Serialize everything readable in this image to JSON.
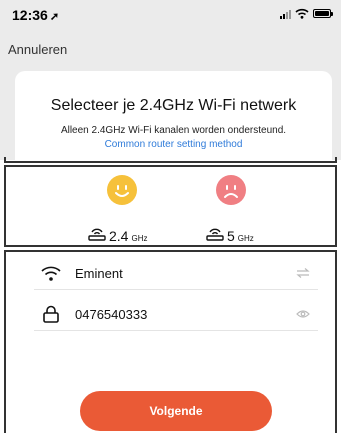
{
  "status_bar": {
    "time": "12:36",
    "location_icon": "location-arrow-icon",
    "signal_icon": "signal-icon",
    "wifi_icon": "wifi-icon",
    "battery_icon": "battery-icon"
  },
  "header": {
    "cancel_label": "Annuleren"
  },
  "card": {
    "title": "Selecteer je 2.4GHz Wi-Fi netwerk",
    "subtitle": "Alleen 2.4GHz Wi-Fi kanalen worden ondersteund.",
    "link_text": "Common router setting method"
  },
  "bands": [
    {
      "freq": "2.4",
      "unit": "GHz",
      "status": "supported",
      "face_icon": "happy-face-icon",
      "color": "#f6c13b"
    },
    {
      "freq": "5",
      "unit": "GHz",
      "status": "not-supported",
      "face_icon": "sad-face-icon",
      "color": "#f07f83"
    }
  ],
  "form": {
    "ssid": "Eminent",
    "ssid_icon": "wifi-icon",
    "ssid_action_icon": "switch-network-icon",
    "password": "0476540333",
    "password_icon": "lock-icon",
    "password_action_icon": "eye-icon"
  },
  "next_label": "Volgende",
  "colors": {
    "accent": "#ea5a36",
    "link": "#2f7bd9",
    "happy": "#f6c13b",
    "sad": "#f07f83"
  }
}
